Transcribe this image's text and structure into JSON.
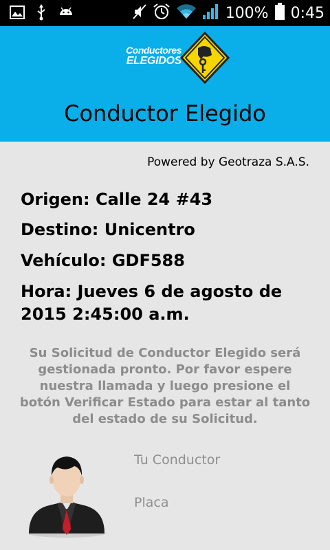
{
  "status_bar": {
    "battery": "100%",
    "time": "0:45",
    "icons": [
      "image-icon",
      "usb-icon",
      "android-icon",
      "mute-icon",
      "alarm-icon",
      "wifi-icon",
      "signal-icon",
      "battery-icon"
    ]
  },
  "header": {
    "logo_line1": "Conductores",
    "logo_line2": "ELEGIDOS",
    "title": "Conductor Elegido",
    "background_color": "#0aaee8"
  },
  "content": {
    "powered_by": "Powered by Geotraza S.A.S.",
    "origin": "Origen: Calle 24 #43",
    "destination": "Destino: Unicentro",
    "vehicle": "Vehículo: GDF588",
    "time": "Hora: Jueves 6 de agosto de 2015 2:45:00 a.m.",
    "message": "Su Solicitud de Conductor Elegido será gestionada pronto. Por favor espere nuestra llamada y luego presione el botón Verificar Estado para estar al tanto del estado de su Solicitud."
  },
  "driver": {
    "name_label": "Tu Conductor",
    "plate_label": "Placa",
    "avatar_icon": "businessman-avatar-icon"
  }
}
